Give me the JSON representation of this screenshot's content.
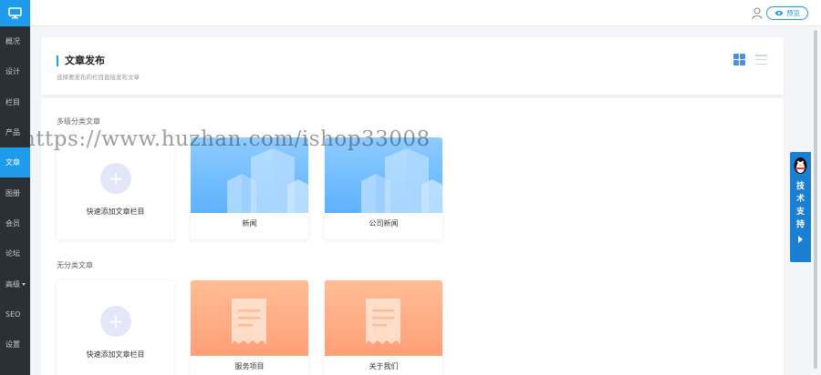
{
  "sidebar": {
    "logo_icon": "monitor-icon",
    "items": [
      {
        "label": "概况"
      },
      {
        "label": "设计"
      },
      {
        "label": "栏目"
      },
      {
        "label": "产品"
      },
      {
        "label": "文章",
        "active": true
      },
      {
        "label": "图册"
      },
      {
        "label": "会员"
      },
      {
        "label": "论坛"
      },
      {
        "label": "高级",
        "has_caret": true
      },
      {
        "label": "SEO"
      },
      {
        "label": "设置"
      }
    ]
  },
  "topbar": {
    "user_icon": "user-icon",
    "preview_icon": "eye-icon",
    "preview_label": "预览"
  },
  "header": {
    "title": "文章发布",
    "subtitle": "选择要发布的栏目直接发布文章",
    "view_toggles": [
      "grid-view-icon",
      "list-view-icon"
    ]
  },
  "sections": [
    {
      "label": "多级分类文章",
      "add_label": "快速添加文章栏目",
      "tiles": [
        {
          "caption": "新闻",
          "theme": "blue"
        },
        {
          "caption": "公司新闻",
          "theme": "blue"
        }
      ]
    },
    {
      "label": "无分类文章",
      "add_label": "快速添加文章栏目",
      "tiles": [
        {
          "caption": "服务项目",
          "theme": "orange"
        },
        {
          "caption": "关于我们",
          "theme": "orange"
        }
      ]
    }
  ],
  "support": {
    "label_chars": [
      "技",
      "术",
      "支",
      "持"
    ],
    "icon": "qq-penguin-icon"
  },
  "watermark": "https://www.huzhan.com/ishop33008",
  "colors": {
    "accent": "#1e9bea",
    "sidebar_bg": "#2b2f36",
    "blue_tile": "#6cbaff",
    "orange_tile": "#ffaa80"
  }
}
